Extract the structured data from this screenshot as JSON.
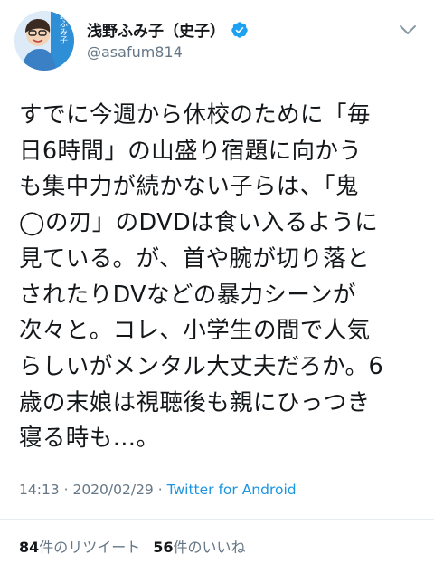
{
  "author": {
    "display_name": "浅野ふみ子（史子）",
    "handle": "@asafum814",
    "verified_badge_icon": "verified-badge-icon",
    "avatar_text": "浅野ふみ子"
  },
  "menu": {
    "icon": "chevron-down-icon"
  },
  "tweet": {
    "lines": [
      "すでに今週から休校のために「毎",
      "日6時間」の山盛り宿題に向かう",
      "も集中力が続かない子らは、「鬼",
      "◯の刃」のDVDは食い入るように",
      "見ている。が、首や腕が切り落と",
      "されたりDVなどの暴力シーンが",
      "次々と。コレ、小学生の間で人気",
      "らしいがメンタル大丈夫だろか。6",
      "歳の末娘は視聴後も親にひっつき",
      "寝る時も…。"
    ]
  },
  "meta": {
    "time": "14:13",
    "separator1": " · ",
    "date": "2020/02/29",
    "separator2": " · ",
    "source": "Twitter for Android"
  },
  "stats": {
    "retweets_count": "84",
    "retweets_label": "件のリツイート",
    "likes_count": "56",
    "likes_label": "件のいいね"
  },
  "colors": {
    "text": "#14171a",
    "secondary": "#657786",
    "link": "#1b95e0",
    "verified": "#1da1f2",
    "divider": "#e6ecf0"
  }
}
